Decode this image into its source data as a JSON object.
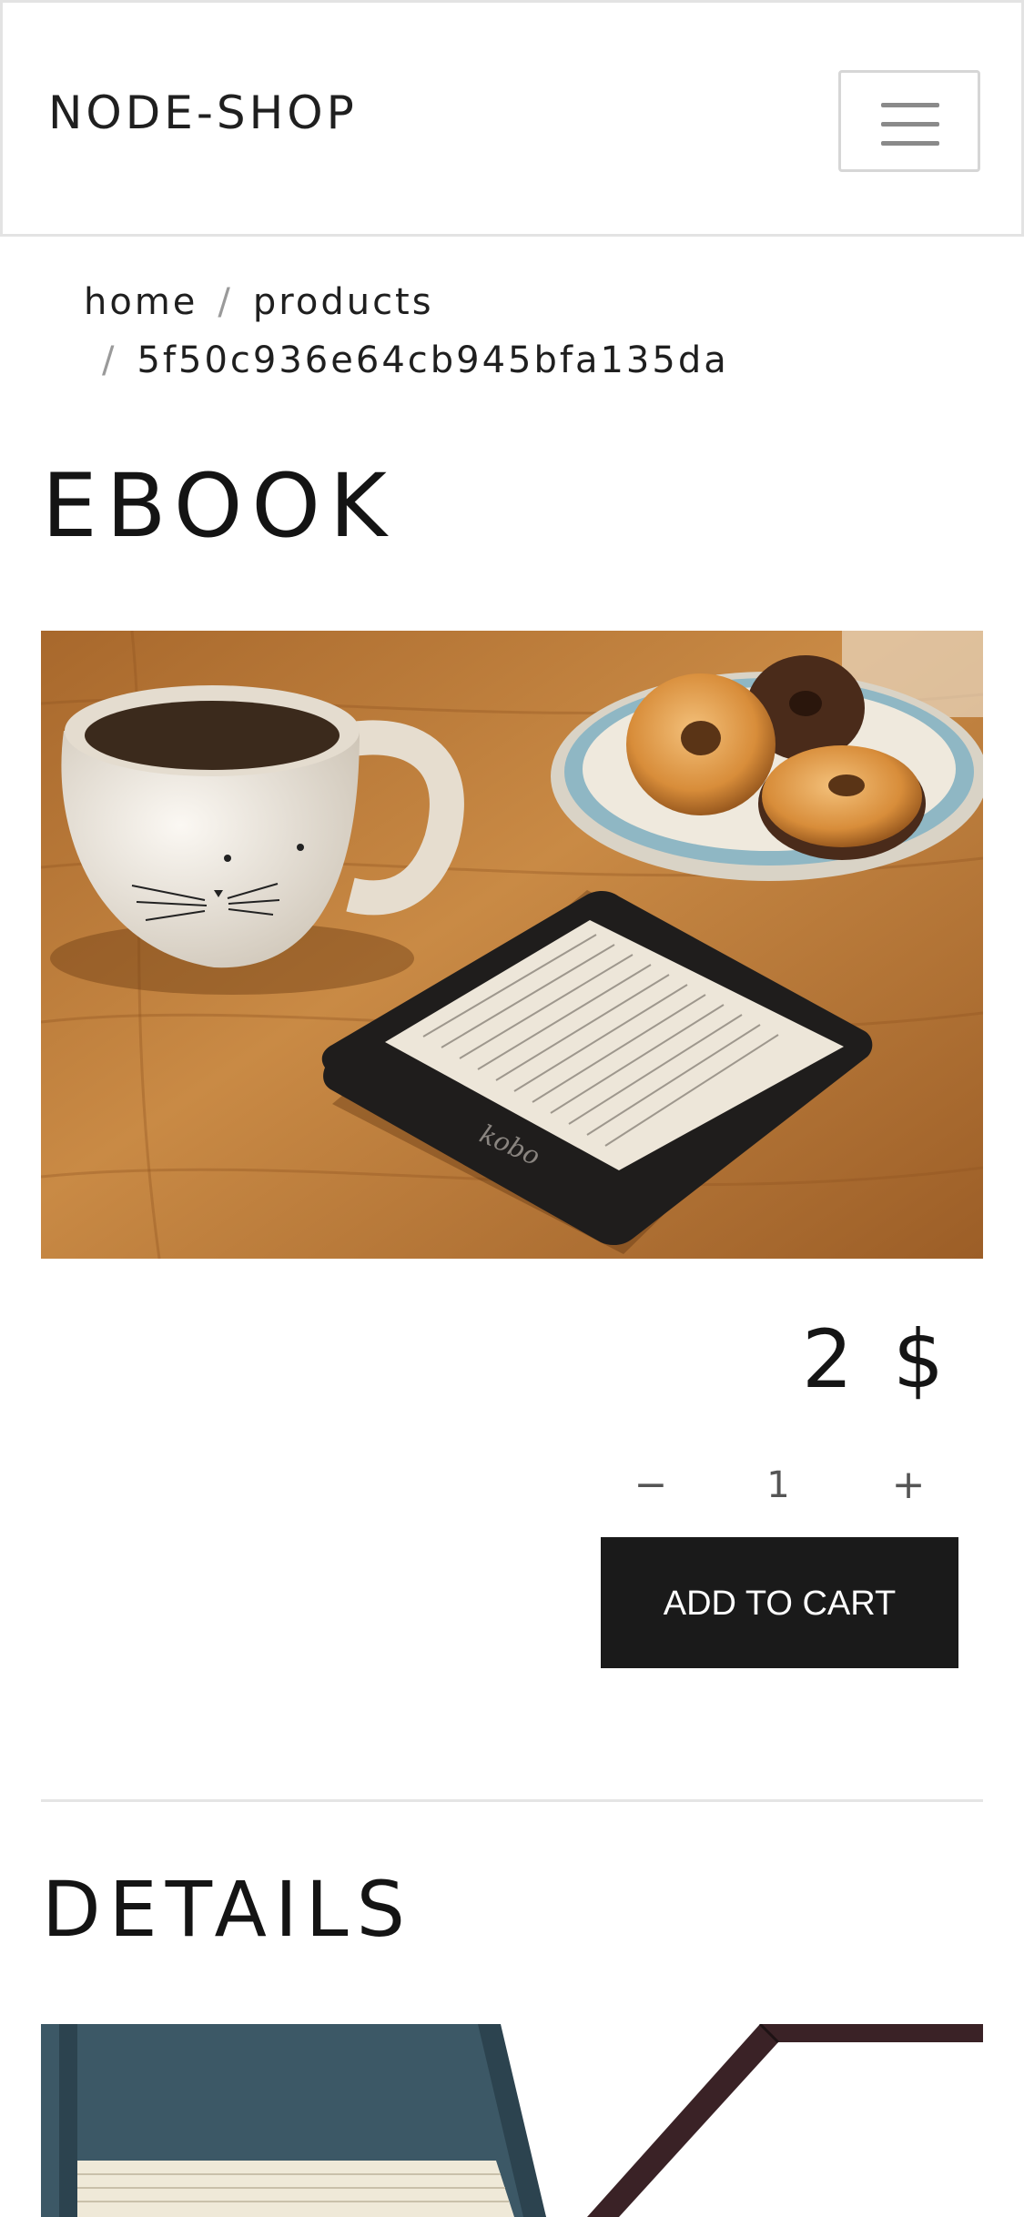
{
  "header": {
    "brand": "NODE-SHOP",
    "menu_icon": "hamburger-menu-icon"
  },
  "breadcrumb": {
    "items": [
      "home",
      "products",
      "5f50c936e64cb945bfa135da"
    ],
    "separator": "/"
  },
  "product": {
    "title": "EBOOK",
    "image": "ebook-reader-with-mug-and-donuts",
    "price": "2 $",
    "quantity": "1",
    "minus_symbol": "−",
    "plus_symbol": "+",
    "add_to_cart_label": "ADD TO CART"
  },
  "details": {
    "title": "DETAILS",
    "image": "book-and-tablet"
  },
  "colors": {
    "button_bg": "#1a1a1a",
    "button_text": "#ffffff",
    "text": "#1b1b1b",
    "border": "#e3e3e3"
  }
}
